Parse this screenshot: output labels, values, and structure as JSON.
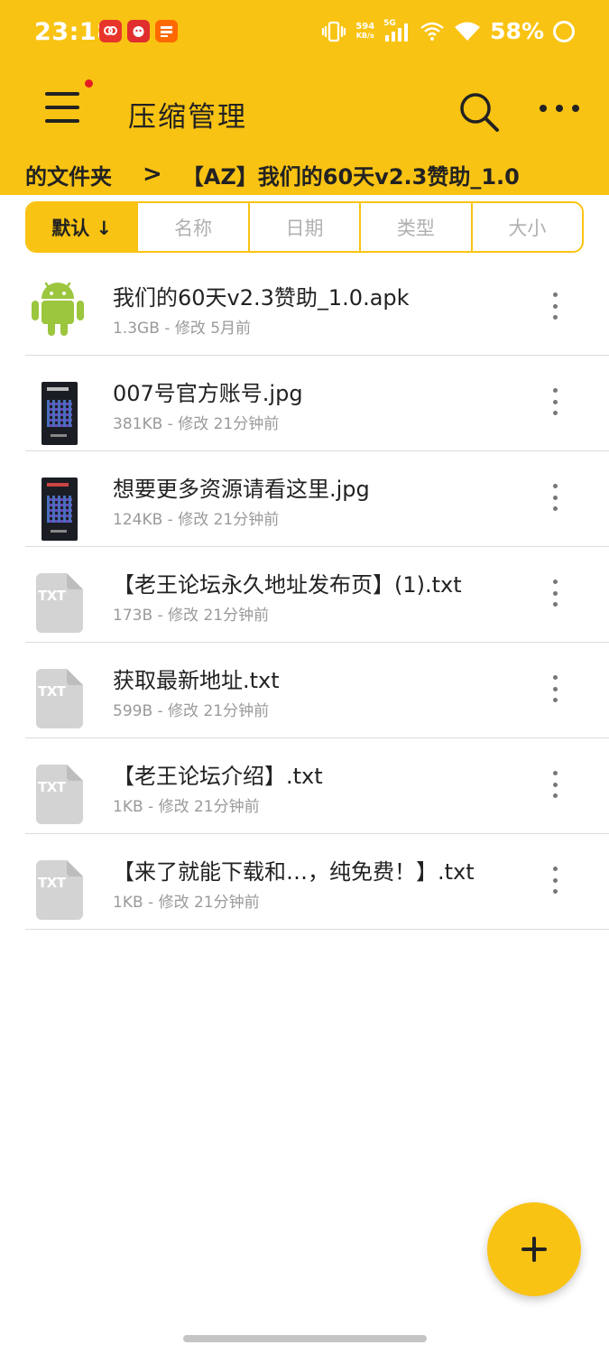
{
  "status_bar": {
    "time": "23:18",
    "net_speed_value": "594",
    "net_speed_unit": "KB/s",
    "network": "5G",
    "battery": "58%"
  },
  "toolbar": {
    "title": "压缩管理",
    "menu_icon": "hamburger-menu-icon",
    "search_icon": "search-icon",
    "more_icon": "more-horizontal-icon"
  },
  "breadcrumb": {
    "parent": "的文件夹",
    "separator": ">",
    "current": "【AZ】我们的60天v2.3赞助_1.0"
  },
  "sort_tabs": [
    {
      "label": "默认 ↓",
      "active": true
    },
    {
      "label": "名称",
      "active": false
    },
    {
      "label": "日期",
      "active": false
    },
    {
      "label": "类型",
      "active": false
    },
    {
      "label": "大小",
      "active": false
    }
  ],
  "files": [
    {
      "name": "我们的60天v2.3赞助_1.0.apk",
      "meta": "1.3GB - 修改 5月前",
      "icon": "android-icon"
    },
    {
      "name": "007号官方账号.jpg",
      "meta": "381KB - 修改 21分钟前",
      "icon": "image-thumbnail"
    },
    {
      "name": "想要更多资源请看这里.jpg",
      "meta": "124KB - 修改 21分钟前",
      "icon": "image-thumbnail"
    },
    {
      "name": "【老王论坛永久地址发布页】(1).txt",
      "meta": "173B - 修改 21分钟前",
      "icon": "txt-file-icon"
    },
    {
      "name": "获取最新地址.txt",
      "meta": "599B - 修改 21分钟前",
      "icon": "txt-file-icon"
    },
    {
      "name": "【老王论坛介绍】.txt",
      "meta": "1KB - 修改 21分钟前",
      "icon": "txt-file-icon"
    },
    {
      "name": "【来了就能下载和…，纯免费！】.txt",
      "meta": "1KB - 修改 21分钟前",
      "icon": "txt-file-icon"
    }
  ],
  "txt_label": "TXT",
  "fab_icon": "plus-icon",
  "colors": {
    "accent": "#f9c313",
    "android": "#9bc63e",
    "txt_icon": "#d3d3d3"
  }
}
